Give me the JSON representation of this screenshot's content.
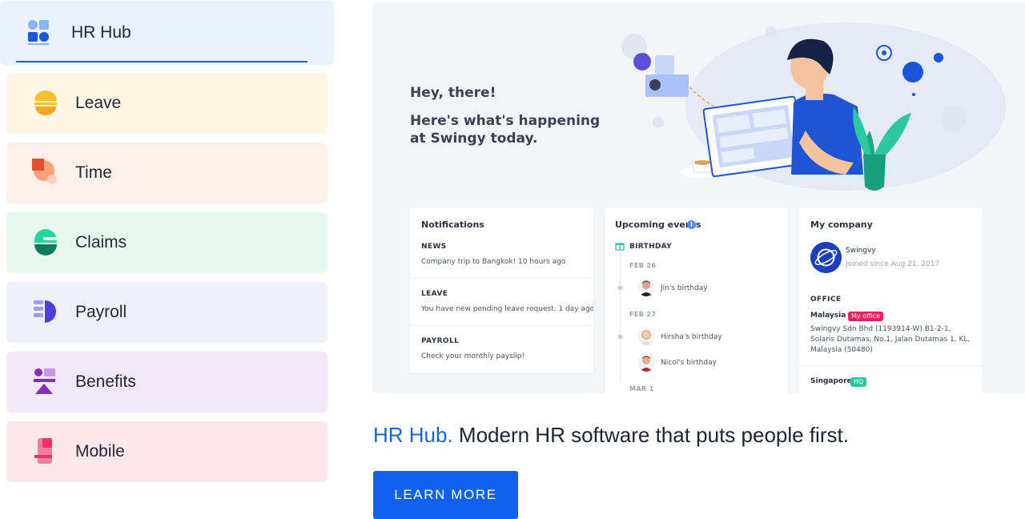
{
  "tabs": [
    {
      "label": "HR Hub",
      "icon": "hr-hub-icon",
      "bg": "#e9f1fe"
    },
    {
      "label": "Leave",
      "icon": "leave-icon",
      "bg": "#fff7e3"
    },
    {
      "label": "Time",
      "icon": "time-icon",
      "bg": "#fdf0ea"
    },
    {
      "label": "Claims",
      "icon": "claims-icon",
      "bg": "#e6f8ef"
    },
    {
      "label": "Payroll",
      "icon": "payroll-icon",
      "bg": "#f0f0fa"
    },
    {
      "label": "Benefits",
      "icon": "benefits-icon",
      "bg": "#f3e8f7"
    },
    {
      "label": "Mobile",
      "icon": "mobile-icon",
      "bg": "#fde6ec"
    }
  ],
  "preview": {
    "greeting": "Hey, there!",
    "subtitle": "Here's what's happening at Swingy today.",
    "notifications": {
      "title": "Notifications",
      "items": [
        {
          "category": "NEWS",
          "text": "Company trip to Bangkok! 10 hours ago"
        },
        {
          "category": "LEAVE",
          "text": "You have new pending leave request. 1 day ago"
        },
        {
          "category": "PAYROLL",
          "text": "Check your monthly payslip!"
        }
      ]
    },
    "events": {
      "title": "Upcoming events",
      "type": "BIRTHDAY",
      "groups": [
        {
          "date": "FEB 26",
          "people": [
            "Jin's birthday"
          ]
        },
        {
          "date": "FEB 27",
          "people": [
            "Hirsha's birthday",
            "Nicol's birthday"
          ]
        },
        {
          "date": "MAR 1",
          "people": []
        }
      ]
    },
    "company": {
      "title": "My company",
      "name": "Swingvy",
      "since": "Joined since Aug 21, 2017",
      "office_label": "OFFICE",
      "offices": [
        {
          "country": "Malaysia",
          "badge": "My office",
          "badge_color": "#e91e63",
          "address": "Swingvy Sdn Bhd (1193914-W) B1-2-1, Solaris Dutamas, No.1, Jalan Dutamas 1, KL, Malaysia (50480)"
        },
        {
          "country": "Singapore",
          "badge": "HQ",
          "badge_color": "#2ec4a6"
        }
      ]
    }
  },
  "tagline": {
    "accent": "HR Hub.",
    "rest": " Modern HR software that puts people first."
  },
  "cta": {
    "label": "LEARN MORE"
  },
  "colors": {
    "accent": "#1565d8",
    "cta": "#1061f0"
  }
}
